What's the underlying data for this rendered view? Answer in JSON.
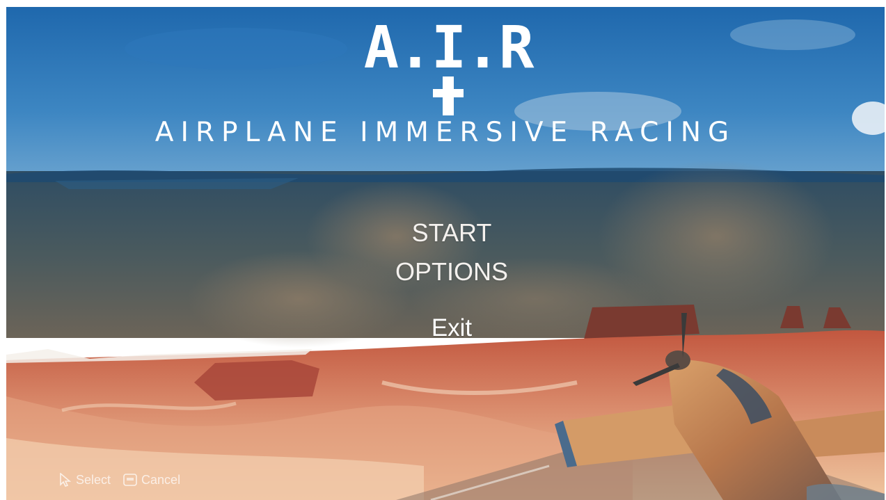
{
  "logo": {
    "mark": "A.I.R",
    "subtitle": "AIRPLANE IMMERSIVE RACING"
  },
  "menu": {
    "items": [
      {
        "label": "START"
      },
      {
        "label": "OPTIONS"
      },
      {
        "label": "Exit"
      }
    ]
  },
  "hints": {
    "select": {
      "icon": "cursor-icon",
      "label": "Select"
    },
    "cancel": {
      "icon": "keyboard-key-icon",
      "label": "Cancel"
    }
  },
  "colors": {
    "sky": "#2a6fb0",
    "canyon_red": "#b4533e",
    "sand": "#e9b48a",
    "text": "#ffffff"
  }
}
